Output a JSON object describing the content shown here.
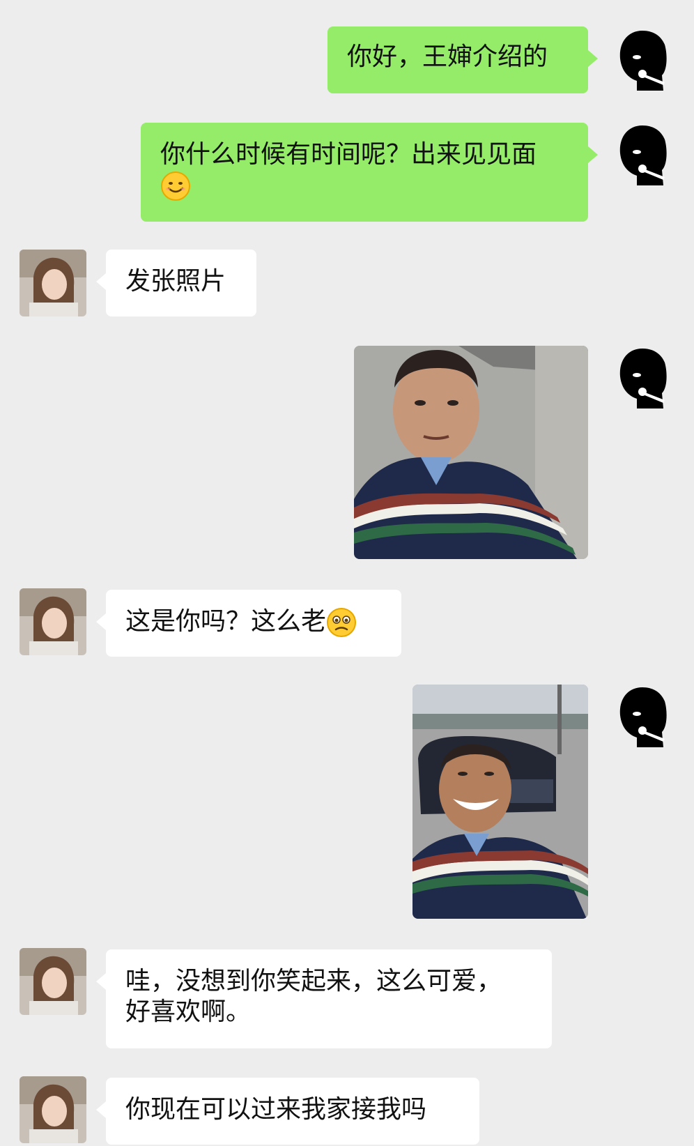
{
  "messages": {
    "m1": {
      "text": "你好，王婶介绍的"
    },
    "m2": {
      "text": "你什么时候有时间呢？出来见见面",
      "emoji": "smile-emoji"
    },
    "m3": {
      "text": "发张照片"
    },
    "m4": {
      "image": "selfie-photo-serious"
    },
    "m5": {
      "text": "这是你吗？这么老",
      "emoji": "worried-emoji"
    },
    "m6": {
      "image": "selfie-photo-smiling-with-car"
    },
    "m7": {
      "line1": "哇，没想到你笑起来，这么可爱，",
      "line2": "好喜欢啊。"
    },
    "m8": {
      "text": "你现在可以过来我家接我吗"
    }
  },
  "avatars": {
    "self": "black-silhouette-avatar",
    "contact": "woman-photo-avatar"
  },
  "colors": {
    "background": "#ededed",
    "sent_bubble": "#95ec69",
    "received_bubble": "#ffffff"
  }
}
